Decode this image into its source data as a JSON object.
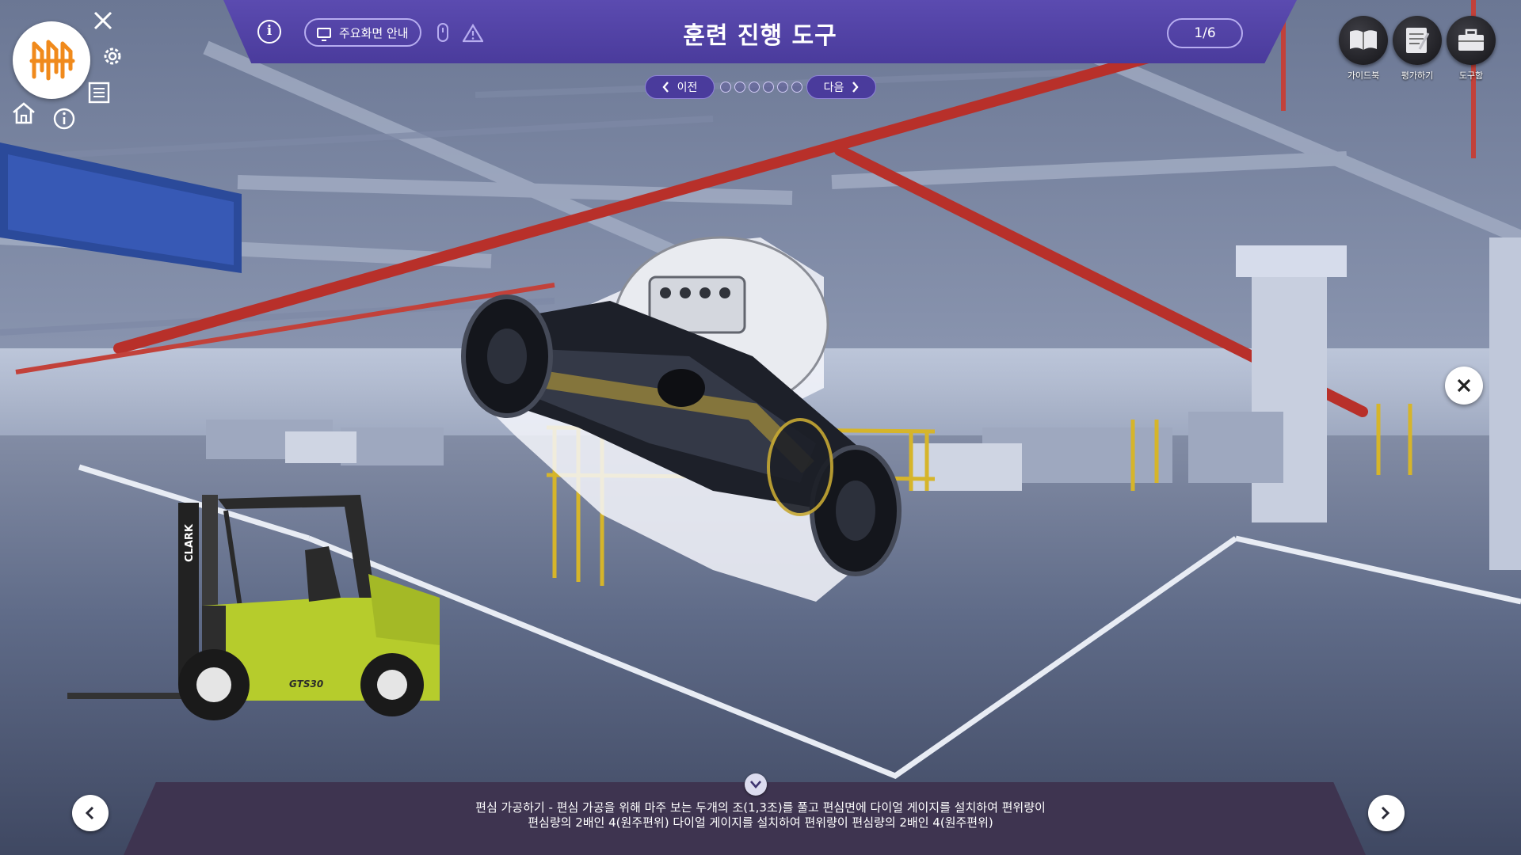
{
  "header": {
    "title": "훈련 진행 도구",
    "main_guide_label": "주요화면 안내",
    "page_indicator": "1/6"
  },
  "step_nav": {
    "prev_label": "이전",
    "next_label": "다음",
    "total_steps": 6,
    "current_step": 1
  },
  "right_tools": [
    {
      "label": "가이드북",
      "icon": "book-icon"
    },
    {
      "label": "평가하기",
      "icon": "notepad-icon"
    },
    {
      "label": "도구함",
      "icon": "toolbox-icon"
    }
  ],
  "forklift_model_text": "GTS30",
  "forklift_brand_text": "CLARK",
  "caption": {
    "line1": "편심 가공하기 - 편심 가공을 위해 마주 보는 두개의 조(1,3조)를 풀고 편심면에 다이얼 게이지를 설치하여 편위량이",
    "line2": "편심량의 2배인 4(원주편위) 다이얼 게이지를 설치하여 편위량이 편심량의 2배인 4(원주편위)"
  },
  "colors": {
    "header_purple": "#4a3b9c",
    "logo_orange": "#f08a1c",
    "forklift_green": "#b6cc2c",
    "floor_line": "#e8ecf4"
  }
}
